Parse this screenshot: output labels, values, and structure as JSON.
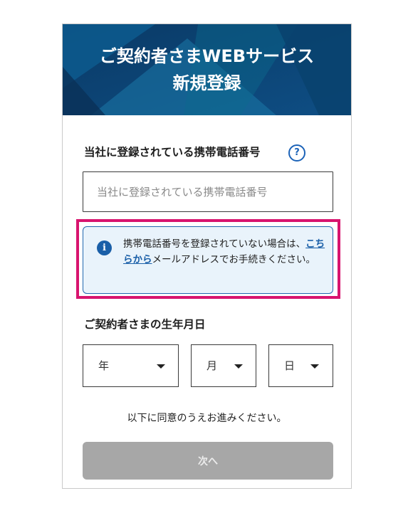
{
  "header": {
    "title_line1": "ご契約者さまWEBサービス",
    "title_line2": "新規登録"
  },
  "phone_section": {
    "label": "当社に登録されている携帯電話番号",
    "help_icon": "question-circle-icon",
    "help_glyph": "?",
    "input_placeholder": "当社に登録されている携帯電話番号",
    "input_value": ""
  },
  "notice": {
    "icon": "info-icon",
    "icon_glyph": "i",
    "text_before": "携帯電話番号を登録されていない場合は、",
    "link_text": "こちらから",
    "text_after": "メールアドレスでお手続きください。"
  },
  "birthdate_section": {
    "label": "ご契約者さまの生年月日",
    "year_label": "年",
    "month_label": "月",
    "day_label": "日"
  },
  "consent_text": "以下に同意のうえお進みください。",
  "next_button_label": "次へ",
  "colors": {
    "header_bg": "#0d3f6e",
    "accent_blue": "#1a5fa8",
    "highlight_border": "#d8146e",
    "notice_bg": "#e9f3fb",
    "disabled_button": "#a7a7a7"
  }
}
